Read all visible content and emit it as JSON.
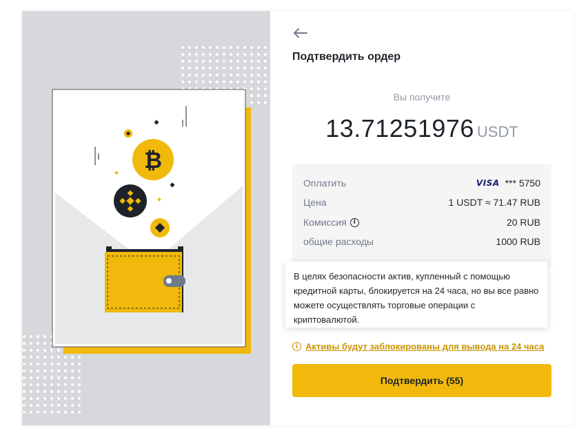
{
  "header": {
    "back_icon": "arrow-left-icon",
    "title": "Подтвердить ордер"
  },
  "receive": {
    "label": "Вы получите",
    "amount": "13.71251976",
    "unit": "USDT"
  },
  "details": {
    "pay": {
      "label": "Оплатить",
      "card_brand": "VISA",
      "card_number": "*** 5750"
    },
    "price": {
      "label": "Цена",
      "value": "1 USDT ≈ 71.47 RUB"
    },
    "fee": {
      "label": "Комиссия",
      "value": "20 RUB",
      "icon": "info-icon"
    },
    "total": {
      "label": "общие расходы",
      "value": "1000 RUB"
    }
  },
  "tooltip": {
    "text": "В целях безопасности актив, купленный с помощью кредитной карты, блокируется на 24 часа, но вы все равно можете осуществлять торговые операции с криптовалютой."
  },
  "warning": {
    "icon": "info-icon",
    "text": "Активы будут заблокированы для вывода на 24 часа"
  },
  "confirm_button": {
    "label": "Подтвердить (55)"
  },
  "colors": {
    "accent": "#f0b90b",
    "warning_text": "#c99400",
    "illustration_bg": "#d7d8dc",
    "details_bg": "#f5f5f5"
  }
}
